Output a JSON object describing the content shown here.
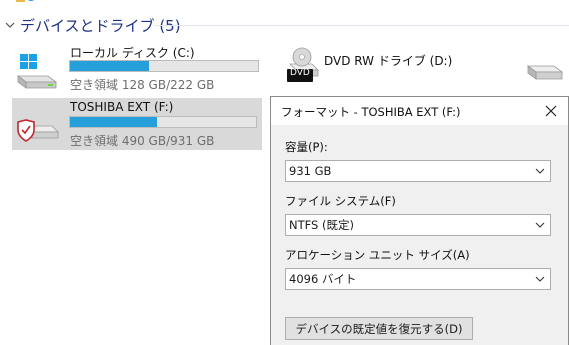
{
  "group": {
    "title": "デバイスとドライブ (5)"
  },
  "drives": {
    "c": {
      "name": "ローカル ディスク (C:)",
      "space": "空き領域 128 GB/222 GB",
      "used_fraction": 0.42
    },
    "f": {
      "name": "TOSHIBA EXT (F:)",
      "space": "空き領域 490 GB/931 GB",
      "used_fraction": 0.47
    },
    "d": {
      "name": "DVD RW ドライブ (D:)",
      "badge": "DVD"
    }
  },
  "dialog": {
    "title": "フォーマット - TOSHIBA EXT (F:)",
    "capacity_label": "容量(P):",
    "capacity_value": "931 GB",
    "filesystem_label": "ファイル システム(F)",
    "filesystem_value": "NTFS (既定)",
    "allocation_label": "アロケーション ユニット サイズ(A)",
    "allocation_value": "4096 バイト",
    "restore_button": "デバイスの既定値を復元する(D)"
  },
  "colors": {
    "accent": "#26a0da",
    "header": "#1e3287",
    "selection": "#d9d9d9"
  }
}
